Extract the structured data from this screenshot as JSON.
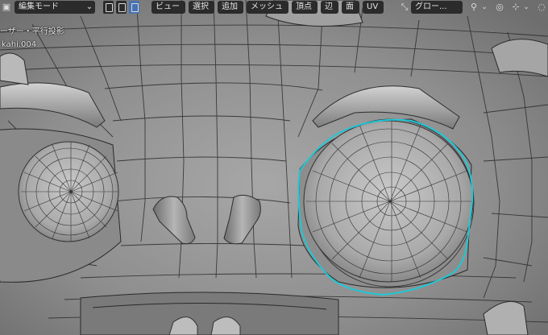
{
  "header": {
    "mode_label": "編集モード",
    "menus": {
      "view": "ビュー",
      "select": "選択",
      "add": "追加",
      "mesh": "メッシュ",
      "vertex": "頂点",
      "edge": "辺",
      "face": "面",
      "uv": "UV"
    },
    "transform_orientation": "グロー...",
    "chevron": "⌄"
  },
  "overlay": {
    "view_name": "ーザー・平行投影",
    "object_name": "kahi.004"
  },
  "colors": {
    "selection": "#1fc7d6",
    "accent": "#4772b3",
    "header_bg": "#2b2b2b"
  }
}
